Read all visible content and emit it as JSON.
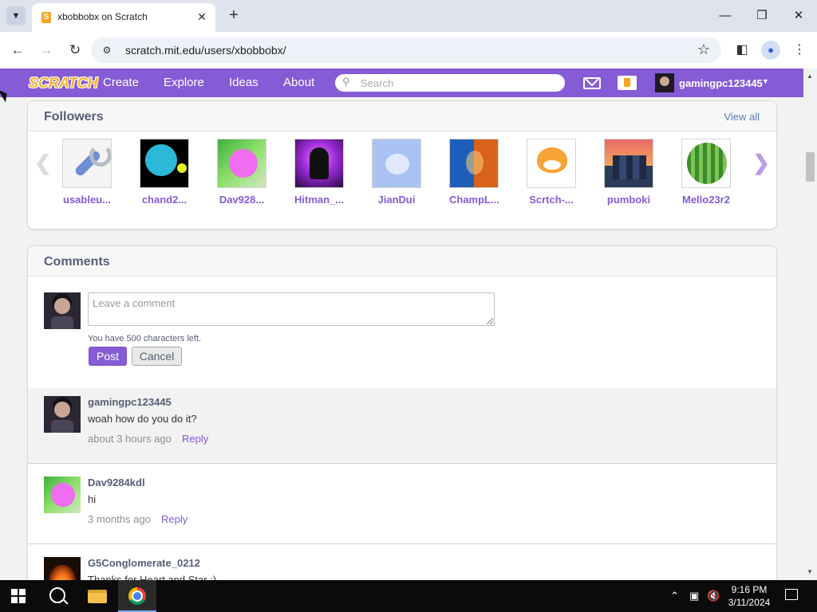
{
  "browser": {
    "tab_title": "xbobbobx on Scratch",
    "favicon_glyph": "S",
    "url": "scratch.mit.edu/users/xbobbobx/"
  },
  "scratch_nav": {
    "logo": "SCRATCH",
    "links": [
      "Create",
      "Explore",
      "Ideas",
      "About"
    ],
    "search_placeholder": "Search",
    "username": "gamingpc123445"
  },
  "followers": {
    "title": "Followers",
    "view_all": "View all",
    "items": [
      {
        "name": "usableu...",
        "art": "wrench"
      },
      {
        "name": "chand2...",
        "art": "chao"
      },
      {
        "name": "Dav928...",
        "art": "pink"
      },
      {
        "name": "Hitman_...",
        "art": "hitman"
      },
      {
        "name": "JianDui",
        "art": "cat-faded"
      },
      {
        "name": "ChampL...",
        "art": "champ"
      },
      {
        "name": "Scrtch-...",
        "art": "scratchcat"
      },
      {
        "name": "pumboki",
        "art": "city"
      },
      {
        "name": "Mello23r2",
        "art": "melon"
      }
    ]
  },
  "comments": {
    "title": "Comments",
    "input_placeholder": "Leave a comment",
    "chars_left": "You have 500 characters left.",
    "post_label": "Post",
    "cancel_label": "Cancel",
    "items": [
      {
        "user": "gamingpc123445",
        "text": "woah how do you do it?",
        "time": "about 3 hours ago",
        "reply": "Reply"
      },
      {
        "user": "Dav9284kdl",
        "text": "hi",
        "time": "3 months ago",
        "reply": "Reply"
      },
      {
        "user": "G5Conglomerate_0212",
        "text": "Thanks for Heart and Star :)",
        "time": "",
        "reply": ""
      }
    ]
  },
  "taskbar": {
    "time": "9:16 PM",
    "date": "3/11/2024"
  },
  "colors": {
    "scratch_purple": "#855cd6",
    "link_blue": "#5b7bb9",
    "text_gray": "#575e75"
  }
}
